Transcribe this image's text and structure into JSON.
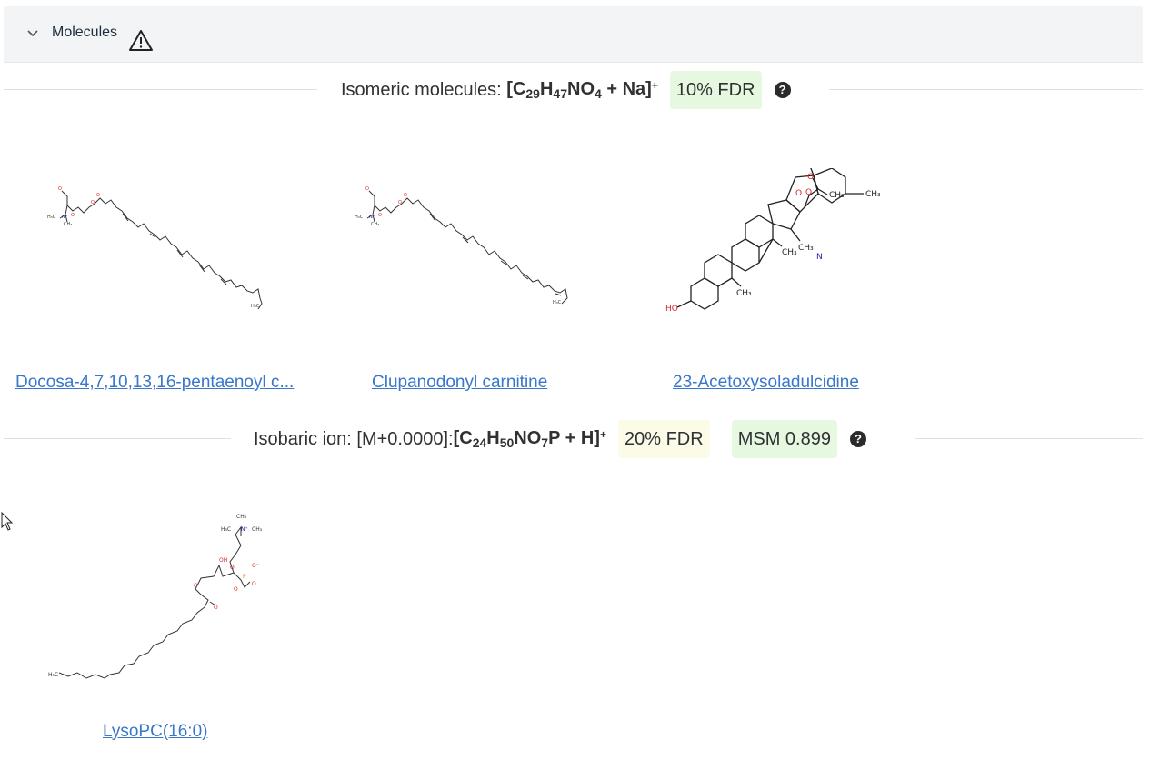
{
  "panel": {
    "title": "Molecules",
    "chevron_icon": "chevron-down-icon",
    "warning_icon": "warning-triangle-icon"
  },
  "isomeric": {
    "prefix": "Isomeric molecules: ",
    "formula_parts": {
      "open": "[C",
      "c": "29",
      "h_label": "H",
      "h": "47",
      "rest": "NO",
      "o": "4",
      "adduct": " + Na]",
      "charge": "+"
    },
    "fdr_badge": "10% FDR",
    "help_icon": "help-circle-icon",
    "help_glyph": "?",
    "molecules": [
      {
        "name": "Docosa-4,7,10,13,16-pentaenoyl c..."
      },
      {
        "name": "Clupanodonyl carnitine"
      },
      {
        "name": "23-Acetoxysoladulcidine"
      }
    ]
  },
  "isobaric": {
    "prefix": "Isobaric ion: [M+0.0000]: ",
    "formula_parts": {
      "open": "[C",
      "c": "24",
      "h_label": "H",
      "h": "50",
      "rest": "NO",
      "o": "7",
      "tail": "P + H]",
      "charge": "+"
    },
    "fdr_badge": "20% FDR",
    "msm_badge": "MSM 0.899",
    "help_icon": "help-circle-icon",
    "help_glyph": "?",
    "molecules": [
      {
        "name": "LysoPC(16:0)"
      }
    ]
  },
  "colors": {
    "link": "#3877c9",
    "badge_green": "#e7f8e1",
    "badge_yellow": "#fbfbe8",
    "header_bg": "#f2f4f6"
  }
}
